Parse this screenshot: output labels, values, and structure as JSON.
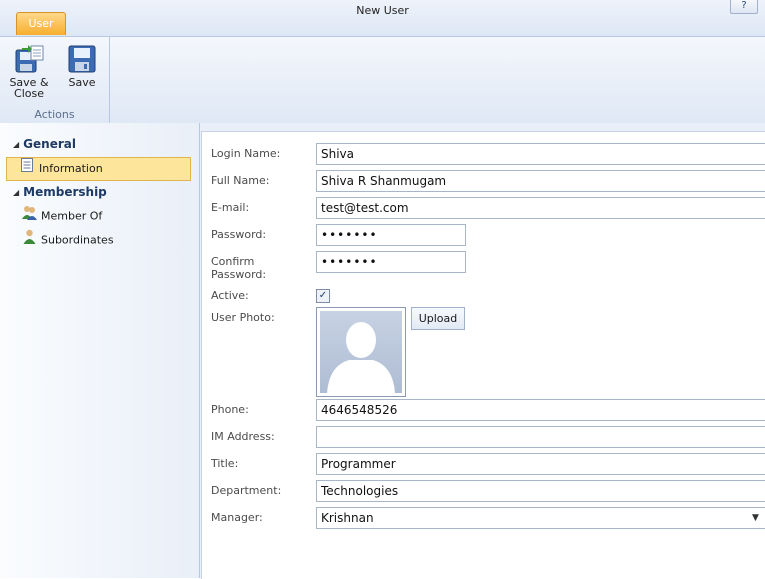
{
  "window": {
    "title": "New User",
    "help_label": "?"
  },
  "ribbon": {
    "tab_label": "User",
    "buttons": [
      {
        "label": "Save &\nClose",
        "icon": "save-close-icon"
      },
      {
        "label": "Save",
        "icon": "save-icon"
      }
    ],
    "group_label": "Actions"
  },
  "nav": {
    "sections": [
      {
        "title": "General",
        "items": [
          {
            "label": "Information",
            "icon": "document-icon",
            "selected": true
          }
        ]
      },
      {
        "title": "Membership",
        "items": [
          {
            "label": "Member Of",
            "icon": "group-icon"
          },
          {
            "label": "Subordinates",
            "icon": "person-icon"
          }
        ]
      }
    ]
  },
  "form": {
    "login_name": {
      "label": "Login Name:",
      "value": "Shiva"
    },
    "full_name": {
      "label": "Full Name:",
      "value": "Shiva R Shanmugam"
    },
    "email": {
      "label": "E-mail:",
      "value": "test@test.com"
    },
    "password": {
      "label": "Password:",
      "value": "•••••••"
    },
    "confirm_password": {
      "label": "Confirm\nPassword:",
      "value": "•••••••"
    },
    "active": {
      "label": "Active:",
      "checked": true,
      "check_glyph": "✓"
    },
    "user_photo": {
      "label": "User Photo:",
      "upload_label": "Upload"
    },
    "phone": {
      "label": "Phone:",
      "value": "4646548526"
    },
    "im_address": {
      "label": "IM Address:",
      "value": ""
    },
    "title": {
      "label": "Title:",
      "value": "Programmer"
    },
    "department": {
      "label": "Department:",
      "value": "Technologies"
    },
    "manager": {
      "label": "Manager:",
      "value": "Krishnan"
    }
  },
  "colors": {
    "accent_tab": "#f7ae2e",
    "selected_nav": "#fde59c",
    "header_text": "#1e3a64"
  }
}
